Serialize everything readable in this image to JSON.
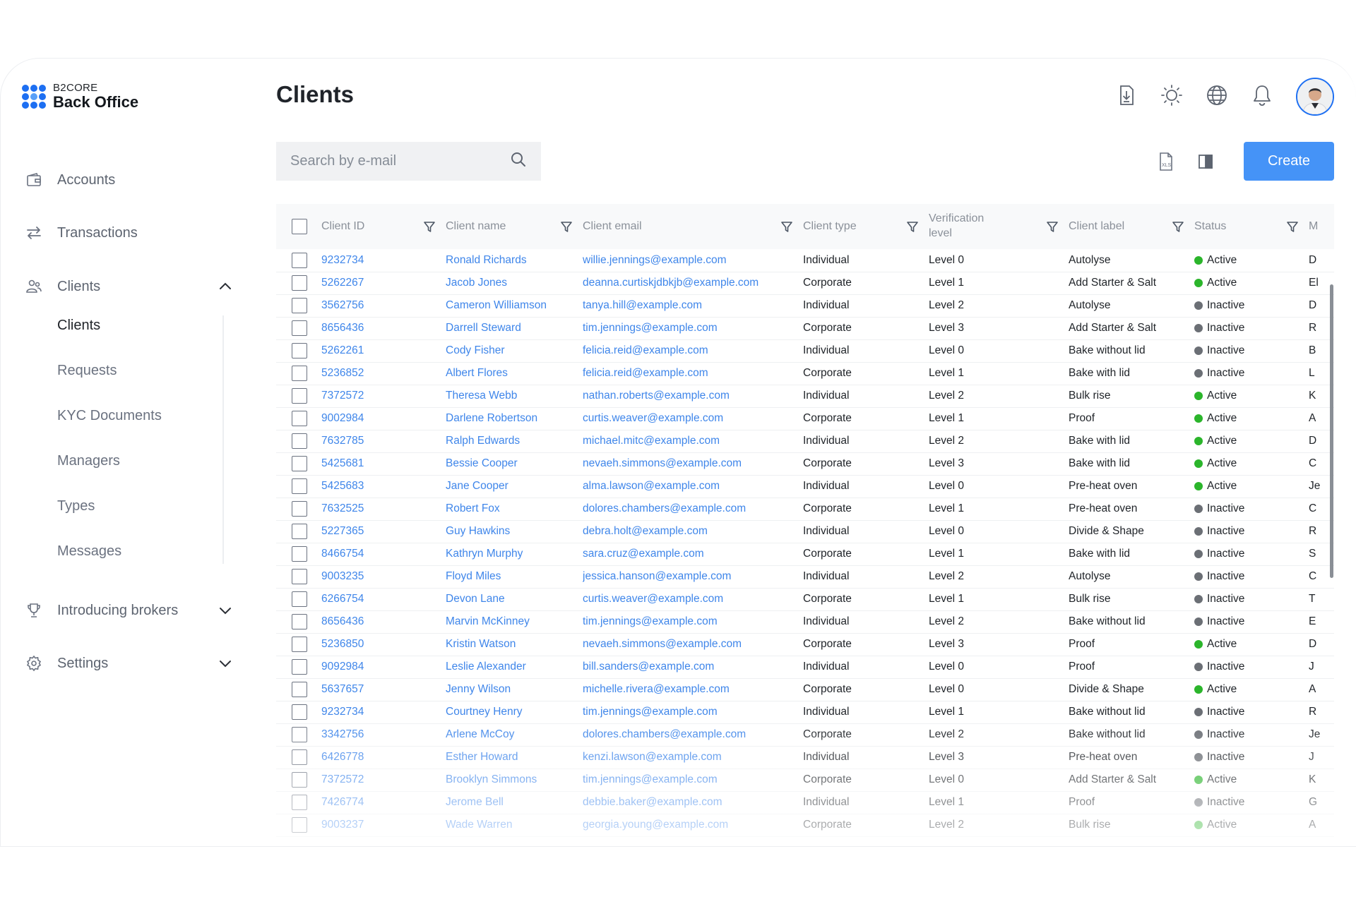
{
  "brand": {
    "name": "B2CORE",
    "product": "Back Office"
  },
  "page": {
    "title": "Clients"
  },
  "sidebar": {
    "items": [
      {
        "label": "Accounts",
        "icon": "wallet-icon"
      },
      {
        "label": "Transactions",
        "icon": "transfer-arrows-icon"
      },
      {
        "label": "Clients",
        "icon": "users-icon",
        "expanded": true,
        "children": [
          "Clients",
          "Requests",
          "KYC Documents",
          "Managers",
          "Types",
          "Messages"
        ],
        "active_child": "Clients"
      },
      {
        "label": "Introducing brokers",
        "icon": "trophy-icon",
        "expanded": false
      },
      {
        "label": "Settings",
        "icon": "gear-icon",
        "expanded": false
      }
    ]
  },
  "header_icons": [
    "download-report-icon",
    "sun-theme-icon",
    "globe-language-icon",
    "bell-icon",
    "avatar"
  ],
  "search": {
    "placeholder": "Search by e-mail",
    "value": ""
  },
  "toolbar": {
    "export_icon": "xls-export-icon",
    "columns_icon": "columns-icon",
    "create_label": "Create"
  },
  "colors": {
    "accent": "#4593f7",
    "link": "#3f86ea",
    "active": "#2bb52b",
    "inactive": "#6b6f75"
  },
  "table": {
    "columns": [
      {
        "label": "Client ID"
      },
      {
        "label": "Client name"
      },
      {
        "label": "Client email"
      },
      {
        "label": "Client type"
      },
      {
        "label": "Verification level"
      },
      {
        "label": "Client label"
      },
      {
        "label": "Status"
      },
      {
        "label": "M"
      }
    ],
    "rows": [
      [
        "9232734",
        "Ronald Richards",
        "willie.jennings@example.com",
        "Individual",
        "Level 0",
        "Autolyse",
        "Active",
        "D"
      ],
      [
        "5262267",
        "Jacob Jones",
        "deanna.curtiskjdbkjb@example.com",
        "Corporate",
        "Level 1",
        "Add Starter & Salt",
        "Active",
        "El"
      ],
      [
        "3562756",
        "Cameron Williamson",
        "tanya.hill@example.com",
        "Individual",
        "Level 2",
        "Autolyse",
        "Inactive",
        "D"
      ],
      [
        "8656436",
        "Darrell Steward",
        "tim.jennings@example.com",
        "Corporate",
        "Level 3",
        "Add Starter & Salt",
        "Inactive",
        "R"
      ],
      [
        "5262261",
        "Cody Fisher",
        "felicia.reid@example.com",
        "Individual",
        "Level 0",
        "Bake without lid",
        "Inactive",
        "B"
      ],
      [
        "5236852",
        "Albert Flores",
        "felicia.reid@example.com",
        "Corporate",
        "Level 1",
        "Bake with lid",
        "Inactive",
        "L"
      ],
      [
        "7372572",
        "Theresa Webb",
        "nathan.roberts@example.com",
        "Individual",
        "Level 2",
        "Bulk rise",
        "Active",
        "K"
      ],
      [
        "9002984",
        "Darlene Robertson",
        "curtis.weaver@example.com",
        "Corporate",
        "Level 1",
        "Proof",
        "Active",
        "A"
      ],
      [
        "7632785",
        "Ralph Edwards",
        "michael.mitc@example.com",
        "Individual",
        "Level 2",
        "Bake with lid",
        "Active",
        "D"
      ],
      [
        "5425681",
        "Bessie Cooper",
        "nevaeh.simmons@example.com",
        "Corporate",
        "Level 3",
        "Bake with lid",
        "Active",
        "C"
      ],
      [
        "5425683",
        "Jane Cooper",
        "alma.lawson@example.com",
        "Individual",
        "Level 0",
        "Pre-heat oven",
        "Active",
        "Je"
      ],
      [
        "7632525",
        "Robert Fox",
        "dolores.chambers@example.com",
        "Corporate",
        "Level 1",
        "Pre-heat oven",
        "Inactive",
        "C"
      ],
      [
        "5227365",
        "Guy Hawkins",
        "debra.holt@example.com",
        "Individual",
        "Level 0",
        "Divide & Shape",
        "Inactive",
        "R"
      ],
      [
        "8466754",
        "Kathryn Murphy",
        "sara.cruz@example.com",
        "Corporate",
        "Level 1",
        "Bake with lid",
        "Inactive",
        "S"
      ],
      [
        "9003235",
        "Floyd Miles",
        "jessica.hanson@example.com",
        "Individual",
        "Level 2",
        "Autolyse",
        "Inactive",
        "C"
      ],
      [
        "6266754",
        "Devon Lane",
        "curtis.weaver@example.com",
        "Corporate",
        "Level 1",
        "Bulk rise",
        "Inactive",
        "T"
      ],
      [
        "8656436",
        "Marvin McKinney",
        "tim.jennings@example.com",
        "Individual",
        "Level 2",
        "Bake without lid",
        "Inactive",
        "E"
      ],
      [
        "5236850",
        "Kristin Watson",
        "nevaeh.simmons@example.com",
        "Corporate",
        "Level 3",
        "Proof",
        "Active",
        "D"
      ],
      [
        "9092984",
        "Leslie Alexander",
        "bill.sanders@example.com",
        "Individual",
        "Level 0",
        "Proof",
        "Inactive",
        "J"
      ],
      [
        "5637657",
        "Jenny Wilson",
        "michelle.rivera@example.com",
        "Corporate",
        "Level 0",
        "Divide & Shape",
        "Active",
        "A"
      ],
      [
        "9232734",
        "Courtney Henry",
        "tim.jennings@example.com",
        "Individual",
        "Level 1",
        "Bake without lid",
        "Inactive",
        "R"
      ],
      [
        "3342756",
        "Arlene McCoy",
        "dolores.chambers@example.com",
        "Corporate",
        "Level 2",
        "Bake without lid",
        "Inactive",
        "Je"
      ],
      [
        "6426778",
        "Esther Howard",
        "kenzi.lawson@example.com",
        "Individual",
        "Level 3",
        "Pre-heat oven",
        "Inactive",
        "J"
      ],
      [
        "7372572",
        "Brooklyn Simmons",
        "tim.jennings@example.com",
        "Corporate",
        "Level 0",
        "Add Starter & Salt",
        "Active",
        "K"
      ],
      [
        "7426774",
        "Jerome Bell",
        "debbie.baker@example.com",
        "Individual",
        "Level 1",
        "Proof",
        "Inactive",
        "G"
      ],
      [
        "9003237",
        "Wade Warren",
        "georgia.young@example.com",
        "Corporate",
        "Level 2",
        "Bulk rise",
        "Active",
        "A"
      ]
    ]
  }
}
